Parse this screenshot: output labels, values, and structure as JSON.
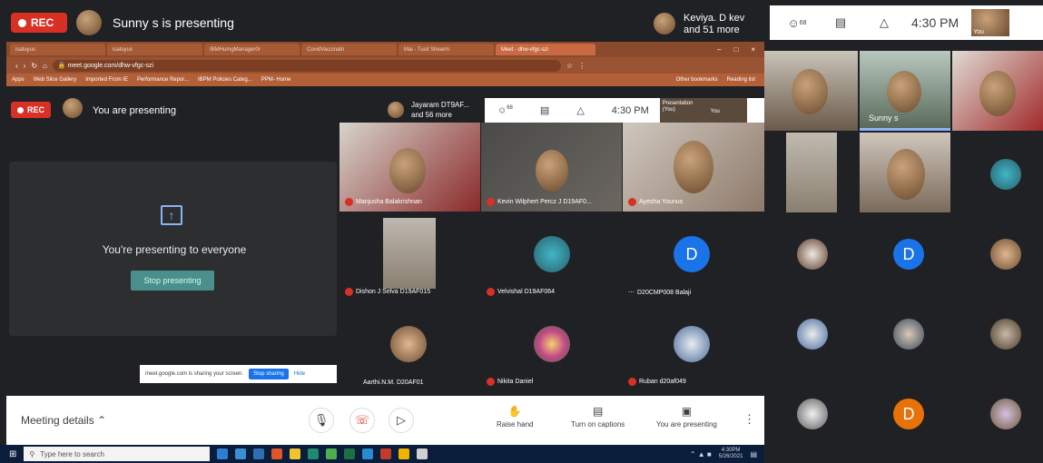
{
  "top": {
    "rec": "REC",
    "title": "Sunny s is presenting",
    "pill_name": "Keviya. D kev",
    "pill_more": "and 51 more",
    "count": "68",
    "time": "4:30 PM",
    "you": "You"
  },
  "browser": {
    "tabs": [
      "isatuyus",
      "isatuyus",
      "IBMHumgManager0r",
      "CovidVaccinatn",
      "Mai - Tusil Shearm",
      "Meet - dhw-vfgc-szi"
    ],
    "url": "meet.google.com/dhw-vfgc-szi",
    "bookmarks": [
      "Apps",
      "Web Slice Gallery",
      "Imported From IE",
      "Performance Repor...",
      "IBPM Policies Categ...",
      "PPM- Home",
      "Other bookmarks",
      "Reading list"
    ]
  },
  "inner": {
    "rec": "REC",
    "presenting": "You are presenting",
    "pill_name": "Jayaram DT9AF...",
    "pill_more": "and 56 more",
    "count": "68",
    "time": "4:30 PM",
    "pres_label": "Presentation (You)",
    "you": "You",
    "panel_text": "You're presenting to everyone",
    "stop": "Stop presenting"
  },
  "tiles": [
    {
      "name": "Manjusha Balakrishnan"
    },
    {
      "name": "Kevin Wilphert Percz J D19AF0..."
    },
    {
      "name": "Ayesha Younus"
    },
    {
      "name": "Dishon J Selva D19AF015"
    },
    {
      "name": "Velvishal D19AF064"
    },
    {
      "name": "D20CMP008 Balaji",
      "letter": "D"
    },
    {
      "name": "Aarthi.N.M. D20AF01"
    },
    {
      "name": "Nikita Daniel"
    },
    {
      "name": "Ruban d20af049"
    }
  ],
  "share": {
    "text": "meet.google.com is sharing your screen.",
    "btn": "Stop sharing",
    "hide": "Hide"
  },
  "bottom": {
    "details": "Meeting details",
    "raise": "Raise hand",
    "captions": "Turn on captions",
    "presenting": "You are presenting"
  },
  "taskbar": {
    "search": "Type here to search",
    "time": "4:30PM",
    "date": "5/26/2021"
  },
  "right": {
    "sunny": "Sunny s",
    "letter1": "D",
    "letter2": "D"
  },
  "colors": {
    "rec": "#d93025",
    "letter_blue": "#1a73e8",
    "letter_orange": "#e8710a"
  }
}
